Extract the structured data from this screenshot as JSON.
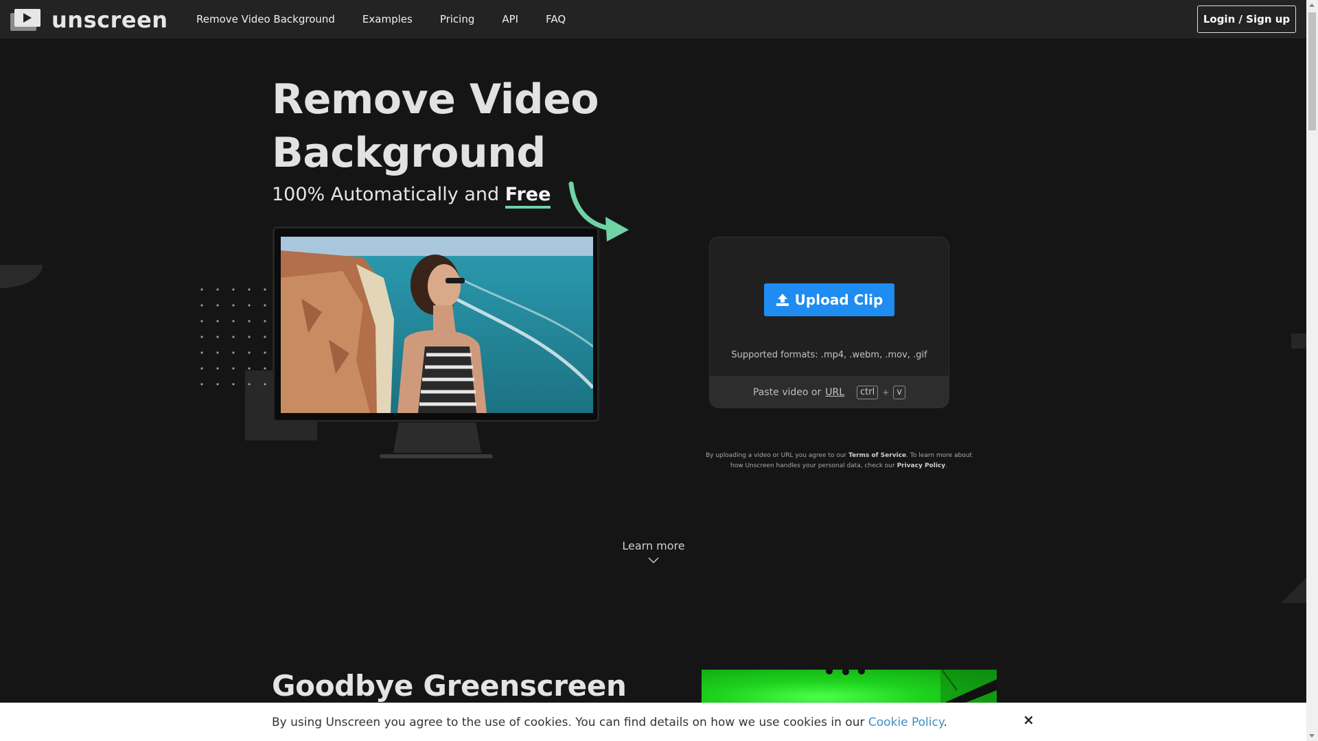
{
  "header": {
    "logo_text": "unscreen",
    "nav_items": [
      {
        "label": "Remove Video Background"
      },
      {
        "label": "Examples"
      },
      {
        "label": "Pricing"
      },
      {
        "label": "API"
      },
      {
        "label": "FAQ"
      }
    ],
    "login_label": "Login / Sign up"
  },
  "hero": {
    "title_line1": "Remove Video",
    "title_line2": "Background",
    "subtitle_prefix": "100% Automatically and",
    "subtitle_emphasis": "Free",
    "accent_color": "#6fd3a5"
  },
  "upload": {
    "button_label": "Upload Clip",
    "button_icon": "upload-icon",
    "button_color": "#1e8cf0",
    "formats_text": "Supported formats: .mp4, .webm, .mov, .gif",
    "paste_prefix": "Paste video or",
    "paste_url_label": "URL",
    "key_ctrl": "ctrl",
    "key_plus": "+",
    "key_v": "v"
  },
  "terms": {
    "part1": "By uploading a video or URL you agree to our",
    "tos_label": "Terms of Service",
    "part2": ". To learn more about how Unscreen handles your personal data, check our",
    "privacy_label": "Privacy Policy",
    "part3": "."
  },
  "learn_more": {
    "label": "Learn more",
    "icon": "chevron-down-icon"
  },
  "section2": {
    "title": "Goodbye Greenscreen"
  },
  "cookie_banner": {
    "text": "By using Unscreen you agree to the use of cookies. You can find details on how we use cookies in our",
    "link_label": "Cookie Policy",
    "suffix": ".",
    "close_label": "×"
  }
}
